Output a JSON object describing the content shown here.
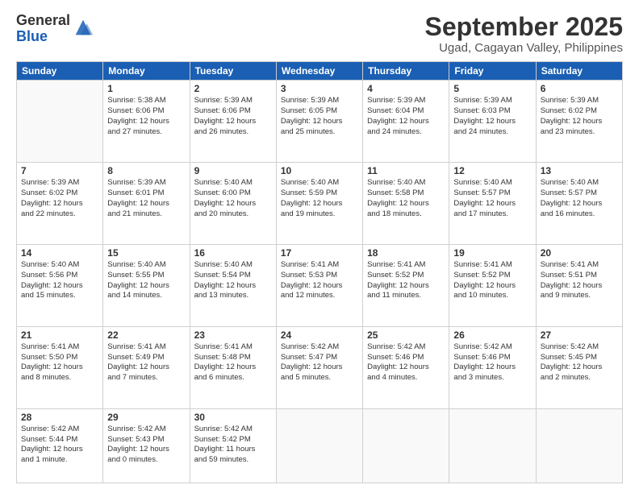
{
  "logo": {
    "general": "General",
    "blue": "Blue"
  },
  "header": {
    "month": "September 2025",
    "location": "Ugad, Cagayan Valley, Philippines"
  },
  "weekdays": [
    "Sunday",
    "Monday",
    "Tuesday",
    "Wednesday",
    "Thursday",
    "Friday",
    "Saturday"
  ],
  "weeks": [
    [
      {
        "day": "",
        "info": ""
      },
      {
        "day": "1",
        "info": "Sunrise: 5:38 AM\nSunset: 6:06 PM\nDaylight: 12 hours\nand 27 minutes."
      },
      {
        "day": "2",
        "info": "Sunrise: 5:39 AM\nSunset: 6:06 PM\nDaylight: 12 hours\nand 26 minutes."
      },
      {
        "day": "3",
        "info": "Sunrise: 5:39 AM\nSunset: 6:05 PM\nDaylight: 12 hours\nand 25 minutes."
      },
      {
        "day": "4",
        "info": "Sunrise: 5:39 AM\nSunset: 6:04 PM\nDaylight: 12 hours\nand 24 minutes."
      },
      {
        "day": "5",
        "info": "Sunrise: 5:39 AM\nSunset: 6:03 PM\nDaylight: 12 hours\nand 24 minutes."
      },
      {
        "day": "6",
        "info": "Sunrise: 5:39 AM\nSunset: 6:02 PM\nDaylight: 12 hours\nand 23 minutes."
      }
    ],
    [
      {
        "day": "7",
        "info": "Sunrise: 5:39 AM\nSunset: 6:02 PM\nDaylight: 12 hours\nand 22 minutes."
      },
      {
        "day": "8",
        "info": "Sunrise: 5:39 AM\nSunset: 6:01 PM\nDaylight: 12 hours\nand 21 minutes."
      },
      {
        "day": "9",
        "info": "Sunrise: 5:40 AM\nSunset: 6:00 PM\nDaylight: 12 hours\nand 20 minutes."
      },
      {
        "day": "10",
        "info": "Sunrise: 5:40 AM\nSunset: 5:59 PM\nDaylight: 12 hours\nand 19 minutes."
      },
      {
        "day": "11",
        "info": "Sunrise: 5:40 AM\nSunset: 5:58 PM\nDaylight: 12 hours\nand 18 minutes."
      },
      {
        "day": "12",
        "info": "Sunrise: 5:40 AM\nSunset: 5:57 PM\nDaylight: 12 hours\nand 17 minutes."
      },
      {
        "day": "13",
        "info": "Sunrise: 5:40 AM\nSunset: 5:57 PM\nDaylight: 12 hours\nand 16 minutes."
      }
    ],
    [
      {
        "day": "14",
        "info": "Sunrise: 5:40 AM\nSunset: 5:56 PM\nDaylight: 12 hours\nand 15 minutes."
      },
      {
        "day": "15",
        "info": "Sunrise: 5:40 AM\nSunset: 5:55 PM\nDaylight: 12 hours\nand 14 minutes."
      },
      {
        "day": "16",
        "info": "Sunrise: 5:40 AM\nSunset: 5:54 PM\nDaylight: 12 hours\nand 13 minutes."
      },
      {
        "day": "17",
        "info": "Sunrise: 5:41 AM\nSunset: 5:53 PM\nDaylight: 12 hours\nand 12 minutes."
      },
      {
        "day": "18",
        "info": "Sunrise: 5:41 AM\nSunset: 5:52 PM\nDaylight: 12 hours\nand 11 minutes."
      },
      {
        "day": "19",
        "info": "Sunrise: 5:41 AM\nSunset: 5:52 PM\nDaylight: 12 hours\nand 10 minutes."
      },
      {
        "day": "20",
        "info": "Sunrise: 5:41 AM\nSunset: 5:51 PM\nDaylight: 12 hours\nand 9 minutes."
      }
    ],
    [
      {
        "day": "21",
        "info": "Sunrise: 5:41 AM\nSunset: 5:50 PM\nDaylight: 12 hours\nand 8 minutes."
      },
      {
        "day": "22",
        "info": "Sunrise: 5:41 AM\nSunset: 5:49 PM\nDaylight: 12 hours\nand 7 minutes."
      },
      {
        "day": "23",
        "info": "Sunrise: 5:41 AM\nSunset: 5:48 PM\nDaylight: 12 hours\nand 6 minutes."
      },
      {
        "day": "24",
        "info": "Sunrise: 5:42 AM\nSunset: 5:47 PM\nDaylight: 12 hours\nand 5 minutes."
      },
      {
        "day": "25",
        "info": "Sunrise: 5:42 AM\nSunset: 5:46 PM\nDaylight: 12 hours\nand 4 minutes."
      },
      {
        "day": "26",
        "info": "Sunrise: 5:42 AM\nSunset: 5:46 PM\nDaylight: 12 hours\nand 3 minutes."
      },
      {
        "day": "27",
        "info": "Sunrise: 5:42 AM\nSunset: 5:45 PM\nDaylight: 12 hours\nand 2 minutes."
      }
    ],
    [
      {
        "day": "28",
        "info": "Sunrise: 5:42 AM\nSunset: 5:44 PM\nDaylight: 12 hours\nand 1 minute."
      },
      {
        "day": "29",
        "info": "Sunrise: 5:42 AM\nSunset: 5:43 PM\nDaylight: 12 hours\nand 0 minutes."
      },
      {
        "day": "30",
        "info": "Sunrise: 5:42 AM\nSunset: 5:42 PM\nDaylight: 11 hours\nand 59 minutes."
      },
      {
        "day": "",
        "info": ""
      },
      {
        "day": "",
        "info": ""
      },
      {
        "day": "",
        "info": ""
      },
      {
        "day": "",
        "info": ""
      }
    ]
  ]
}
